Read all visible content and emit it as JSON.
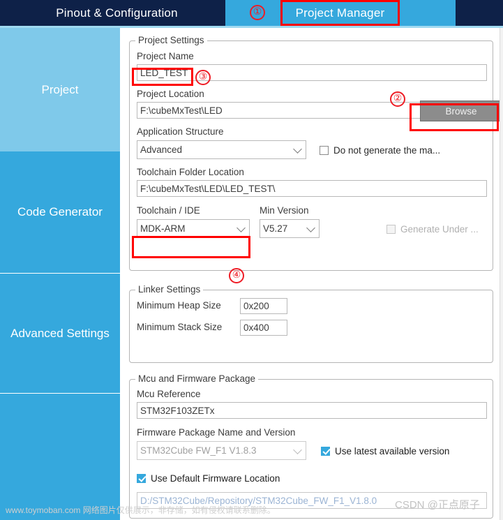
{
  "tabs": {
    "pinout_label": "Pinout & Configuration",
    "project_manager_label": "Project Manager"
  },
  "annotations": {
    "one": "①",
    "two": "②",
    "three": "③",
    "four": "④"
  },
  "sidebar": {
    "items": [
      {
        "label": "Project"
      },
      {
        "label": "Code Generator"
      },
      {
        "label": "Advanced Settings"
      }
    ]
  },
  "project_settings": {
    "legend": "Project Settings",
    "project_name_label": "Project Name",
    "project_name_value": "LED_TEST",
    "project_location_label": "Project Location",
    "project_location_value": "F:\\cubeMxTest\\LED",
    "browse_label": "Browse",
    "application_structure_label": "Application Structure",
    "application_structure_value": "Advanced",
    "do_not_generate_label": "Do not generate the ma...",
    "do_not_generate_checked": false,
    "toolchain_folder_label": "Toolchain Folder Location",
    "toolchain_folder_value": "F:\\cubeMxTest\\LED\\LED_TEST\\",
    "toolchain_ide_label": "Toolchain / IDE",
    "toolchain_ide_value": "MDK-ARM",
    "min_version_label": "Min Version",
    "min_version_value": "V5.27",
    "generate_under_label": "Generate Under ...",
    "generate_under_checked": false
  },
  "linker_settings": {
    "legend": "Linker Settings",
    "min_heap_label": "Minimum Heap Size",
    "min_heap_value": "0x200",
    "min_stack_label": "Minimum Stack Size",
    "min_stack_value": "0x400"
  },
  "mcu_firmware": {
    "legend": "Mcu and Firmware Package",
    "mcu_reference_label": "Mcu Reference",
    "mcu_reference_value": "STM32F103ZETx",
    "firmware_package_label": "Firmware Package Name and Version",
    "firmware_package_value": "STM32Cube FW_F1 V1.8.3",
    "use_latest_label": "Use latest available version",
    "use_latest_checked": true,
    "use_default_location_label": "Use Default Firmware Location",
    "use_default_location_checked": true,
    "firmware_location_value": "D:/STM32Cube/Repository/STM32Cube_FW_F1_V1.8.0"
  },
  "watermarks": {
    "left": "www.toymoban.com 网络图片仅供展示，非存储，如有侵权请联系删除。",
    "csdn": "CSDN @正点原子"
  },
  "colors": {
    "tab_dark": "#0e2148",
    "accent_blue": "#35a8dd",
    "accent_light": "#7fc9ea",
    "annotation_red": "#ff0000"
  }
}
